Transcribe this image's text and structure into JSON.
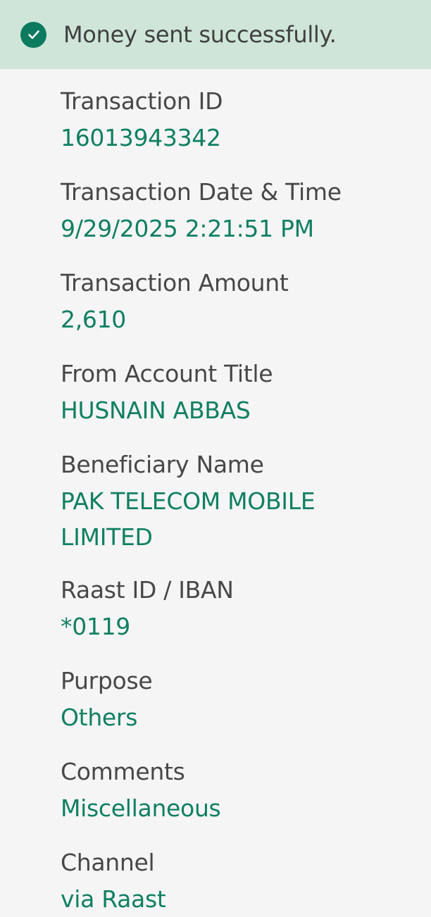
{
  "status": {
    "message": "Money sent successfully.",
    "icon": "check-circle-icon",
    "background_color": "#cfe5d8",
    "icon_color": "#0b7a5e"
  },
  "details": [
    {
      "label": "Transaction ID",
      "value": "16013943342"
    },
    {
      "label": "Transaction Date & Time",
      "value": "9/29/2025 2:21:51 PM"
    },
    {
      "label": "Transaction Amount",
      "value": "2,610"
    },
    {
      "label": "From Account Title",
      "value": "HUSNAIN ABBAS"
    },
    {
      "label": "Beneficiary Name",
      "value": "PAK TELECOM MOBILE LIMITED"
    },
    {
      "label": "Raast ID / IBAN",
      "value": "*0119"
    },
    {
      "label": "Purpose",
      "value": "Others"
    },
    {
      "label": "Comments",
      "value": "Miscellaneous"
    },
    {
      "label": "Channel",
      "value": "via Raast"
    }
  ],
  "colors": {
    "label": "#474747",
    "value": "#0f7f62",
    "page_background": "#f5f5f5"
  }
}
